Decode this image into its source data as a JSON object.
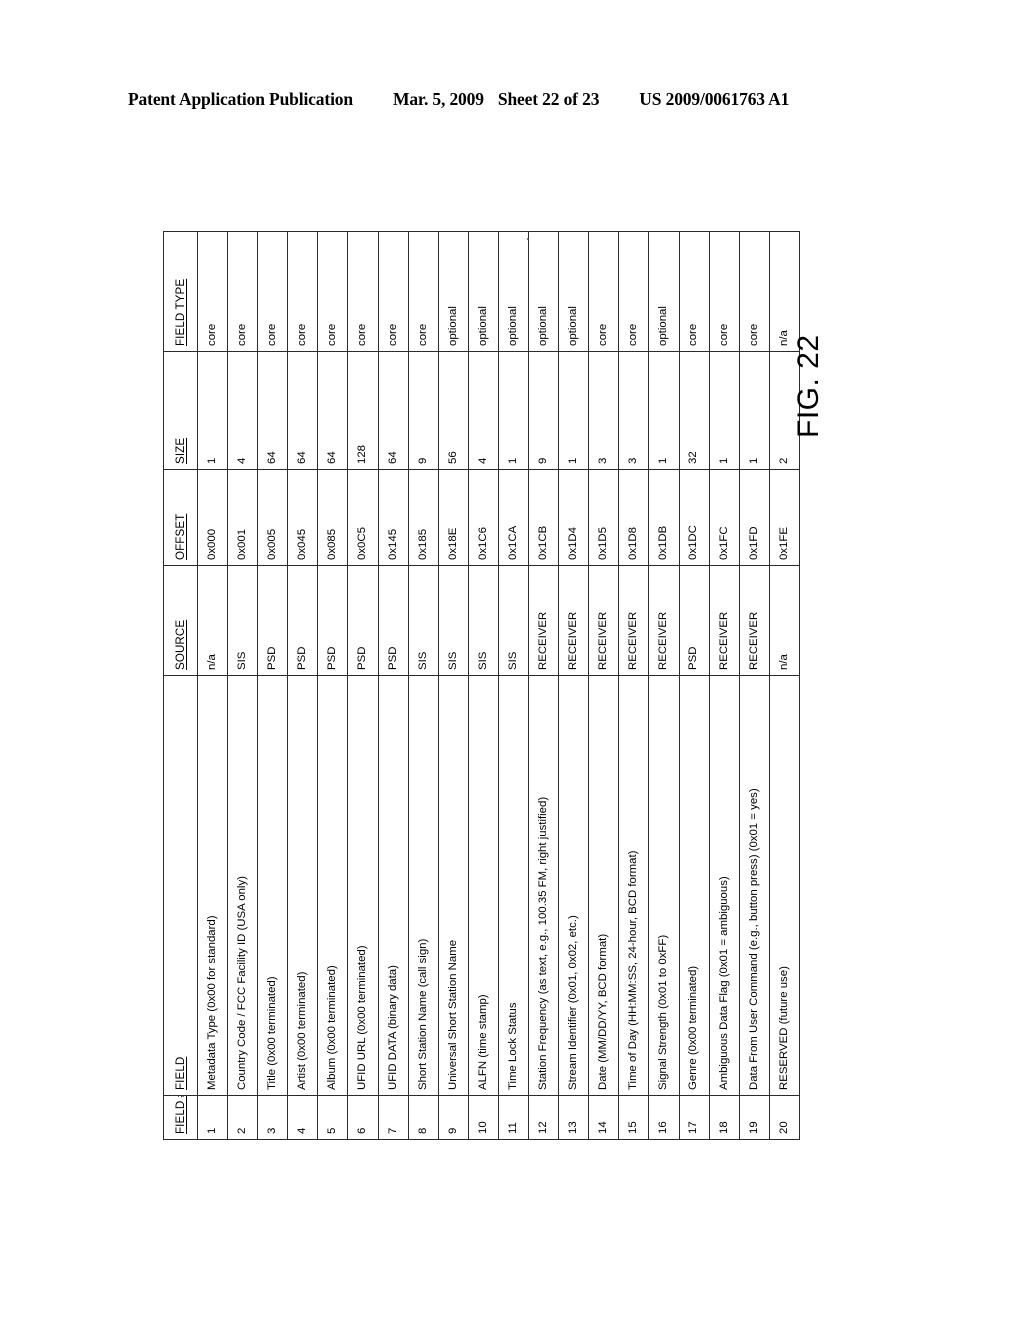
{
  "header": {
    "publication": "Patent Application Publication",
    "date": "Mar. 5, 2009",
    "sheet": "Sheet 22 of 23",
    "number": "US 2009/0061763 A1"
  },
  "figure": {
    "caption": "FIG. 22"
  },
  "table": {
    "columns": [
      "FIELD #",
      "FIELD",
      "SOURCE",
      "OFFSET",
      "SIZE",
      "FIELD TYPE"
    ],
    "rows": [
      {
        "num": "1",
        "field": "Metadata Type (0x00 for standard)",
        "source": "n/a",
        "offset": "0x000",
        "size": "1",
        "type": "core"
      },
      {
        "num": "2",
        "field": "Country Code / FCC Facility ID (USA only)",
        "source": "SIS",
        "offset": "0x001",
        "size": "4",
        "type": "core"
      },
      {
        "num": "3",
        "field": "Title (0x00 terminated)",
        "source": "PSD",
        "offset": "0x005",
        "size": "64",
        "type": "core"
      },
      {
        "num": "4",
        "field": "Artist (0x00 terminated)",
        "source": "PSD",
        "offset": "0x045",
        "size": "64",
        "type": "core"
      },
      {
        "num": "5",
        "field": "Album (0x00 terminated)",
        "source": "PSD",
        "offset": "0x085",
        "size": "64",
        "type": "core"
      },
      {
        "num": "6",
        "field": "UFID URL (0x00 terminated)",
        "source": "PSD",
        "offset": "0x0C5",
        "size": "128",
        "type": "core"
      },
      {
        "num": "7",
        "field": "UFID DATA (binary data)",
        "source": "PSD",
        "offset": "0x145",
        "size": "64",
        "type": "core"
      },
      {
        "num": "8",
        "field": "Short Station Name (call sign)",
        "source": "SIS",
        "offset": "0x185",
        "size": "9",
        "type": "core"
      },
      {
        "num": "9",
        "field": "Universal Short Station Name",
        "source": "SIS",
        "offset": "0x18E",
        "size": "56",
        "type": "optional"
      },
      {
        "num": "10",
        "field": "ALFN (time stamp)",
        "source": "SIS",
        "offset": "0x1C6",
        "size": "4",
        "type": "optional"
      },
      {
        "num": "11",
        "field": "Time Lock Status",
        "source": "SIS",
        "offset": "0x1CA",
        "size": "1",
        "type": "optional"
      },
      {
        "num": "12",
        "field": "Station Frequency (as text, e.g., 100.35 FM, right justified)",
        "source": "RECEIVER",
        "offset": "0x1CB",
        "size": "9",
        "type": "optional"
      },
      {
        "num": "13",
        "field": "Stream Identifier (0x01, 0x02, etc.)",
        "source": "RECEIVER",
        "offset": "0x1D4",
        "size": "1",
        "type": "optional"
      },
      {
        "num": "14",
        "field": "Date (MM/DD/YY, BCD format)",
        "source": "RECEIVER",
        "offset": "0x1D5",
        "size": "3",
        "type": "core"
      },
      {
        "num": "15",
        "field": "Time of Day (HH:MM:SS, 24-hour, BCD format)",
        "source": "RECEIVER",
        "offset": "0x1D8",
        "size": "3",
        "type": "core"
      },
      {
        "num": "16",
        "field": "Signal Strength (0x01 to 0xFF)",
        "source": "RECEIVER",
        "offset": "0x1DB",
        "size": "1",
        "type": "optional"
      },
      {
        "num": "17",
        "field": "Genre (0x00 terminated)",
        "source": "PSD",
        "offset": "0x1DC",
        "size": "32",
        "type": "core"
      },
      {
        "num": "18",
        "field": "Ambiguous Data Flag (0x01 = ambiguous)",
        "source": "RECEIVER",
        "offset": "0x1FC",
        "size": "1",
        "type": "core"
      },
      {
        "num": "19",
        "field": "Data From User Command (e.g., button press) (0x01 = yes)",
        "source": "RECEIVER",
        "offset": "0x1FD",
        "size": "1",
        "type": "core"
      },
      {
        "num": "20",
        "field": "RESERVED (future use)",
        "source": "n/a",
        "offset": "0x1FE",
        "size": "2",
        "type": "n/a"
      }
    ]
  }
}
